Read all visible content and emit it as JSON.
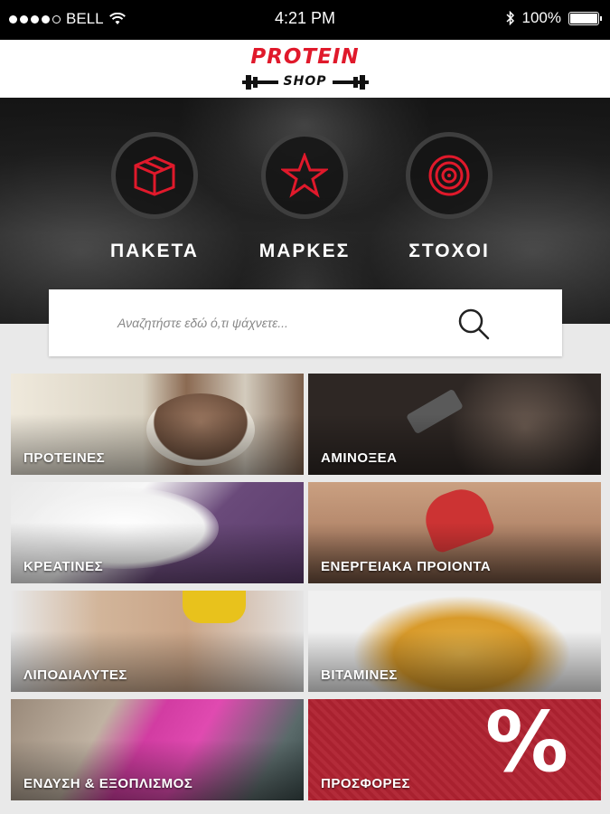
{
  "status_bar": {
    "carrier": "BELL",
    "time": "4:21 PM",
    "battery": "100%"
  },
  "header": {
    "logo_word1": "PROTEIN",
    "logo_word2": "SHOP"
  },
  "hero": {
    "items": [
      {
        "label": "ΠΑΚΕΤΑ",
        "icon": "box-icon"
      },
      {
        "label": "ΜΑΡΚΕΣ",
        "icon": "star-icon"
      },
      {
        "label": "ΣΤΟΧΟΙ",
        "icon": "target-icon"
      }
    ]
  },
  "search": {
    "placeholder": "Αναζητήστε εδώ ό,τι ψάχνετε..."
  },
  "categories": [
    {
      "label": "ΠΡΟΤΕΙΝΕΣ"
    },
    {
      "label": "ΑΜΙΝΟΞΕΑ"
    },
    {
      "label": "ΚΡΕΑΤΙΝΕΣ"
    },
    {
      "label": "ΕΝΕΡΓΕΙΑΚΑ ΠΡΟΙΟΝΤΑ"
    },
    {
      "label": "ΛΙΠΟΔΙΑΛΥΤΕΣ"
    },
    {
      "label": "ΒΙΤΑΜΙΝΕΣ"
    },
    {
      "label": "ΕΝΔΥΣΗ & ΕΞΟΠΛΙΣΜΟΣ"
    },
    {
      "label": "ΠΡΟΣΦΟΡΕΣ"
    }
  ],
  "offers_symbol": "%",
  "colors": {
    "brand_red": "#e0192b",
    "offers_red": "#b02231"
  }
}
